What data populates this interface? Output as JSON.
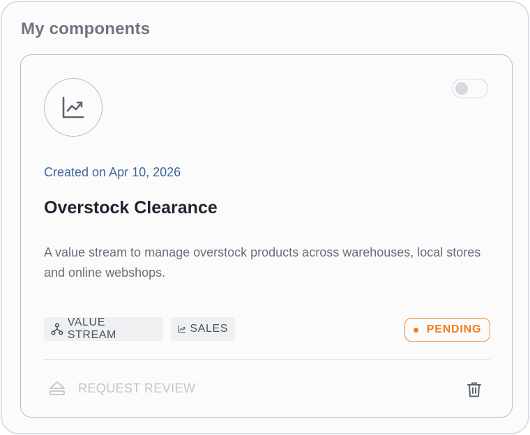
{
  "panel": {
    "title": "My components"
  },
  "card": {
    "icon": "chart-line-icon",
    "enabled": false,
    "created": "Created on Apr 10, 2026",
    "title": "Overstock Clearance",
    "description": "A value stream to manage overstock products across warehouses, local stores and online webshops.",
    "tags": [
      {
        "label": "VALUE STREAM",
        "icon": "value-stream-icon"
      },
      {
        "label": "SALES",
        "icon": "chart-line-icon"
      }
    ],
    "status": {
      "label": "PENDING",
      "color": "#f07f1b"
    },
    "actions": {
      "request_review_label": "REQUEST REVIEW",
      "request_review_icon": "eject-icon",
      "delete_icon": "trash-icon"
    }
  },
  "colors": {
    "accent_blue": "#3f6699",
    "pending_orange": "#f07f1b",
    "card_border": "#a9bfd9"
  }
}
